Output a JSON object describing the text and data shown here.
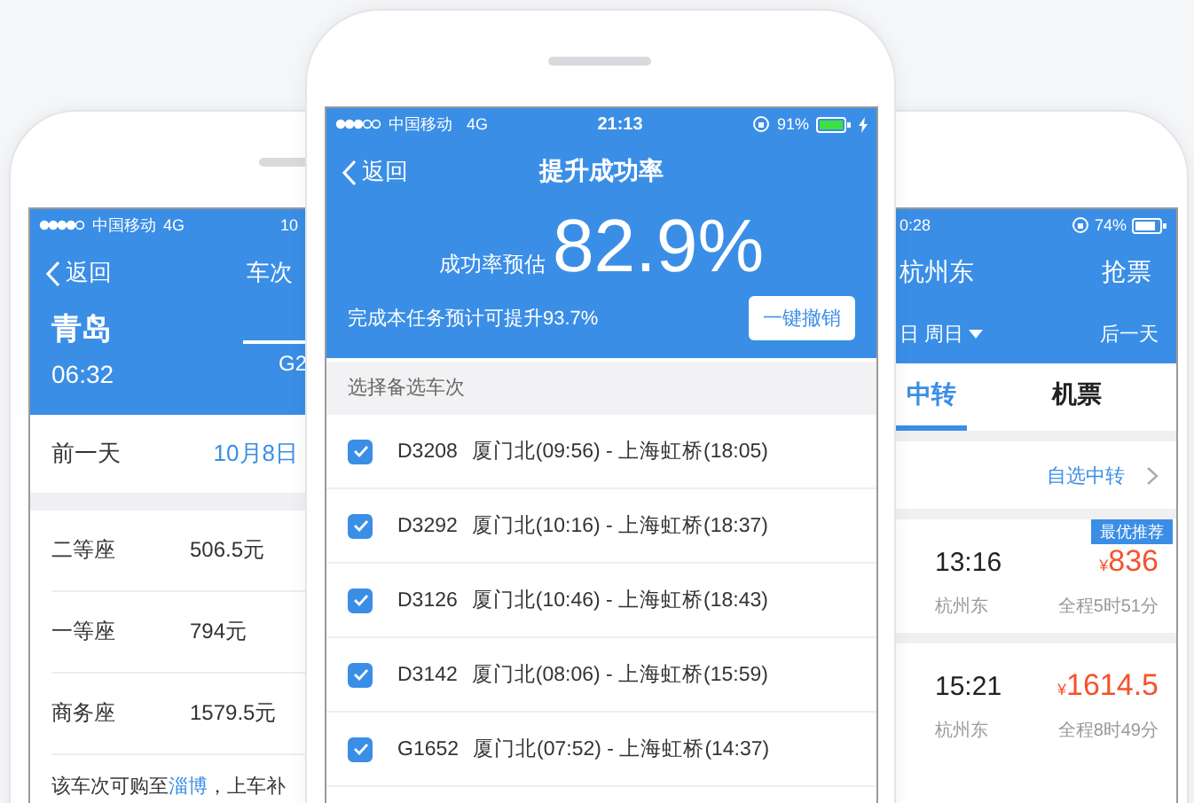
{
  "left_phone": {
    "status_bar": {
      "carrier": "中国移动",
      "network": "4G",
      "time": "10"
    },
    "nav": {
      "back": "返回",
      "title": "车次"
    },
    "header": {
      "station": "青岛",
      "time": "06:32",
      "train": "G2"
    },
    "date_row": {
      "label": "前一天",
      "date": "10月8日"
    },
    "seats": [
      {
        "class": "二等座",
        "price": "506.5元"
      },
      {
        "class": "一等座",
        "price": "794元"
      },
      {
        "class": "商务座",
        "price": "1579.5元"
      }
    ],
    "note": {
      "text": "该车次可购至",
      "link": "淄博",
      "rest": "，上车补"
    }
  },
  "center_phone": {
    "status_bar": {
      "carrier": "中国移动",
      "network": "4G",
      "time": "21:13",
      "battery": "91%"
    },
    "nav": {
      "back": "返回",
      "title": "提升成功率"
    },
    "rate": {
      "label": "成功率预估",
      "value": "82.9%"
    },
    "hint": "完成本任务预计可提升93.7%",
    "cancel_button": "一键撤销",
    "section_title": "选择备选车次",
    "trains": [
      {
        "code": "D3208",
        "route": "厦门北(09:56) - 上海虹桥(18:05)",
        "checked": true
      },
      {
        "code": "D3292",
        "route": "厦门北(10:16) - 上海虹桥(18:37)",
        "checked": true
      },
      {
        "code": "D3126",
        "route": "厦门北(10:46) - 上海虹桥(18:43)",
        "checked": true
      },
      {
        "code": "D3142",
        "route": "厦门北(08:06) - 上海虹桥(15:59)",
        "checked": true
      },
      {
        "code": "G1652",
        "route": "厦门北(07:52) - 上海虹桥(14:37)",
        "checked": true
      }
    ]
  },
  "right_phone": {
    "status_bar": {
      "time": "0:28",
      "battery": "74%"
    },
    "nav": {
      "title": "杭州东",
      "action": "抢票"
    },
    "date_bar": {
      "date": "日 周日",
      "next": "后一天"
    },
    "tabs": [
      {
        "label": "中转",
        "selected": true
      },
      {
        "label": "机票",
        "selected": false
      }
    ],
    "custom_transfer": "自选中转",
    "results": [
      {
        "badge": "最优推荐",
        "time": "13:16",
        "currency": "¥",
        "price": "836",
        "station": "杭州东",
        "duration": "全程5时51分"
      },
      {
        "time": "15:21",
        "currency": "¥",
        "price": "1614.5",
        "station": "杭州东",
        "duration": "全程8时49分"
      }
    ]
  }
}
